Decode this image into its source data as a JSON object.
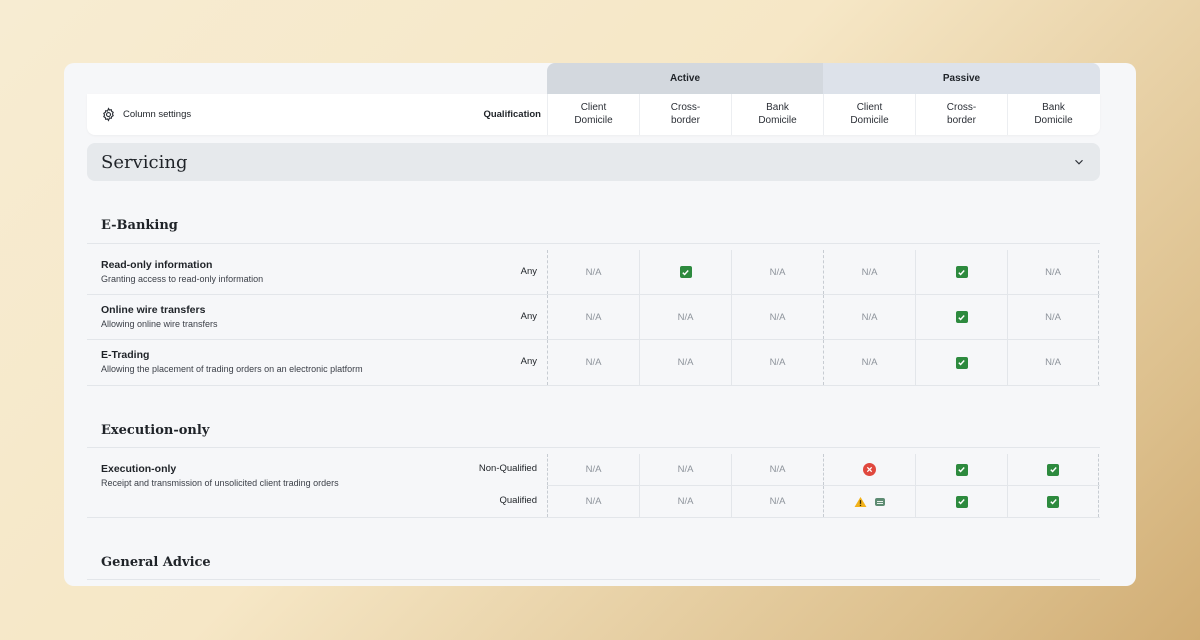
{
  "header": {
    "groups": [
      {
        "label": "Active"
      },
      {
        "label": "Passive"
      }
    ],
    "column_settings_label": "Column settings",
    "qualification_label": "Qualification",
    "columns": [
      {
        "line1": "Client",
        "line2": "Domicile"
      },
      {
        "line1": "Cross-",
        "line2": "border"
      },
      {
        "line1": "Bank",
        "line2": "Domicile"
      },
      {
        "line1": "Client",
        "line2": "Domicile"
      },
      {
        "line1": "Cross-",
        "line2": "border"
      },
      {
        "line1": "Bank",
        "line2": "Domicile"
      }
    ]
  },
  "section": {
    "title": "Servicing"
  },
  "groups": [
    {
      "title": "E-Banking",
      "rows": [
        {
          "name": "Read-only information",
          "desc": "Granting access to read-only information",
          "qualification": "Any",
          "cells": [
            "N/A",
            "check",
            "N/A",
            "N/A",
            "check",
            "N/A"
          ]
        },
        {
          "name": "Online wire transfers",
          "desc": "Allowing online wire transfers",
          "qualification": "Any",
          "cells": [
            "N/A",
            "N/A",
            "N/A",
            "N/A",
            "check",
            "N/A"
          ]
        },
        {
          "name": "E-Trading",
          "desc": "Allowing the placement of trading orders on an electronic platform",
          "qualification": "Any",
          "cells": [
            "N/A",
            "N/A",
            "N/A",
            "N/A",
            "check",
            "N/A"
          ]
        }
      ]
    },
    {
      "title": "Execution-only",
      "rows": [
        {
          "name": "Execution-only",
          "desc": "Receipt and transmission of unsolicited client trading orders",
          "sub": [
            {
              "qualification": "Non-Qualified",
              "cells": [
                "N/A",
                "N/A",
                "N/A",
                "cross",
                "check",
                "check"
              ]
            },
            {
              "qualification": "Qualified",
              "cells": [
                "N/A",
                "N/A",
                "N/A",
                "warning+note",
                "check",
                "check"
              ]
            }
          ]
        }
      ]
    },
    {
      "title": "General Advice",
      "rows": []
    }
  ],
  "colors": {
    "check": "#2d8a3e",
    "cross": "#e0483e",
    "warning": "#f2b21b",
    "active_header": "#d3d8de",
    "passive_header": "#dde2ea"
  },
  "icons": {
    "settings": "gear-icon",
    "collapse": "chevron-down-icon",
    "check": "check-icon",
    "cross": "error-icon",
    "warning": "warning-icon",
    "note": "note-icon"
  }
}
